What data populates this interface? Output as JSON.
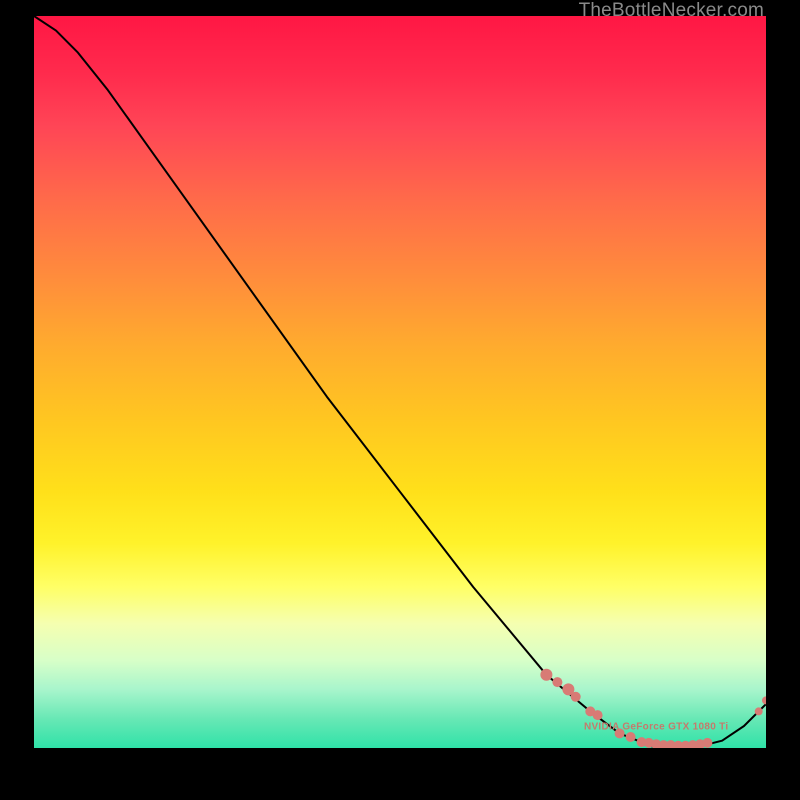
{
  "watermark": "TheBottleNecker.com",
  "label": "NVIDIA GeForce GTX 1080 Ti",
  "chart_data": {
    "type": "line",
    "title": "",
    "xlabel": "",
    "ylabel": "",
    "xlim": [
      0,
      100
    ],
    "ylim": [
      0,
      100
    ],
    "curve": [
      {
        "x": 0,
        "y": 100
      },
      {
        "x": 3,
        "y": 98
      },
      {
        "x": 6,
        "y": 95
      },
      {
        "x": 10,
        "y": 90
      },
      {
        "x": 15,
        "y": 83
      },
      {
        "x": 20,
        "y": 76
      },
      {
        "x": 30,
        "y": 62
      },
      {
        "x": 40,
        "y": 48
      },
      {
        "x": 50,
        "y": 35
      },
      {
        "x": 60,
        "y": 22
      },
      {
        "x": 70,
        "y": 10
      },
      {
        "x": 76,
        "y": 5
      },
      {
        "x": 80,
        "y": 2
      },
      {
        "x": 85,
        "y": 0
      },
      {
        "x": 90,
        "y": 0
      },
      {
        "x": 94,
        "y": 1
      },
      {
        "x": 97,
        "y": 3
      },
      {
        "x": 100,
        "y": 6
      }
    ],
    "cluster_points": [
      {
        "x": 70,
        "y": 10,
        "r": 6
      },
      {
        "x": 71.5,
        "y": 9,
        "r": 5
      },
      {
        "x": 73,
        "y": 8,
        "r": 6
      },
      {
        "x": 74,
        "y": 7,
        "r": 5
      },
      {
        "x": 76,
        "y": 5,
        "r": 5
      },
      {
        "x": 77,
        "y": 4.5,
        "r": 5
      },
      {
        "x": 80,
        "y": 2,
        "r": 5
      },
      {
        "x": 81.5,
        "y": 1.5,
        "r": 5
      },
      {
        "x": 83,
        "y": 0.8,
        "r": 5
      },
      {
        "x": 84,
        "y": 0.7,
        "r": 5
      },
      {
        "x": 85,
        "y": 0.5,
        "r": 5
      },
      {
        "x": 86,
        "y": 0.4,
        "r": 5
      },
      {
        "x": 87,
        "y": 0.4,
        "r": 5
      },
      {
        "x": 88,
        "y": 0.3,
        "r": 5
      },
      {
        "x": 89,
        "y": 0.3,
        "r": 5
      },
      {
        "x": 90,
        "y": 0.4,
        "r": 5
      },
      {
        "x": 91,
        "y": 0.5,
        "r": 5
      },
      {
        "x": 92,
        "y": 0.7,
        "r": 5
      },
      {
        "x": 99,
        "y": 5,
        "r": 4
      },
      {
        "x": 100,
        "y": 6.5,
        "r": 4
      }
    ],
    "label_anchor": {
      "x": 85,
      "y": 2.5
    }
  }
}
